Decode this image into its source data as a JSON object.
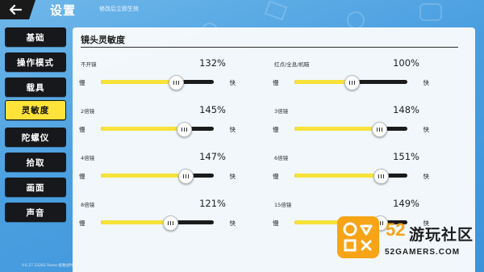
{
  "header": {
    "title": "设置",
    "subtitle": "修改后立即生效"
  },
  "sidebar": {
    "items": [
      {
        "label": "基础",
        "active": false
      },
      {
        "label": "操作模式",
        "active": false
      },
      {
        "label": "载具",
        "active": false
      },
      {
        "label": "灵敏度",
        "active": true
      },
      {
        "label": "陀螺仪",
        "active": false
      },
      {
        "label": "拾取",
        "active": false
      },
      {
        "label": "画面",
        "active": false
      },
      {
        "label": "声音",
        "active": false
      }
    ]
  },
  "panel": {
    "title": "镜头灵敏度",
    "settings": [
      {
        "label": "不开镜",
        "value": "132%",
        "min_label": "慢",
        "max_label": "快",
        "level": 0.66
      },
      {
        "label": "红点/全息/机瞄",
        "value": "100%",
        "min_label": "慢",
        "max_label": "快",
        "level": 0.5
      },
      {
        "label": "2倍镜",
        "value": "145%",
        "min_label": "慢",
        "max_label": "快",
        "level": 0.73
      },
      {
        "label": "3倍镜",
        "value": "148%",
        "min_label": "慢",
        "max_label": "快",
        "level": 0.74
      },
      {
        "label": "4倍镜",
        "value": "147%",
        "min_label": "慢",
        "max_label": "快",
        "level": 0.74
      },
      {
        "label": "6倍镜",
        "value": "151%",
        "min_label": "慢",
        "max_label": "快",
        "level": 0.76
      },
      {
        "label": "8倍镜",
        "value": "121%",
        "min_label": "慢",
        "max_label": "快",
        "level": 0.61
      },
      {
        "label": "15倍镜",
        "value": "149%",
        "min_label": "慢",
        "max_label": "快",
        "level": 0.75
      }
    ]
  },
  "footer": {
    "version": "V.0.27.33282 Rome·极致战时"
  },
  "watermark": {
    "number": "52",
    "name": "游玩社区",
    "domain": "52GAMERS.COM"
  },
  "colors": {
    "accent": "#f7e23a",
    "active_tab": "#ffe33a",
    "watermark": "#f7a417",
    "background": "#4a9fe0"
  }
}
